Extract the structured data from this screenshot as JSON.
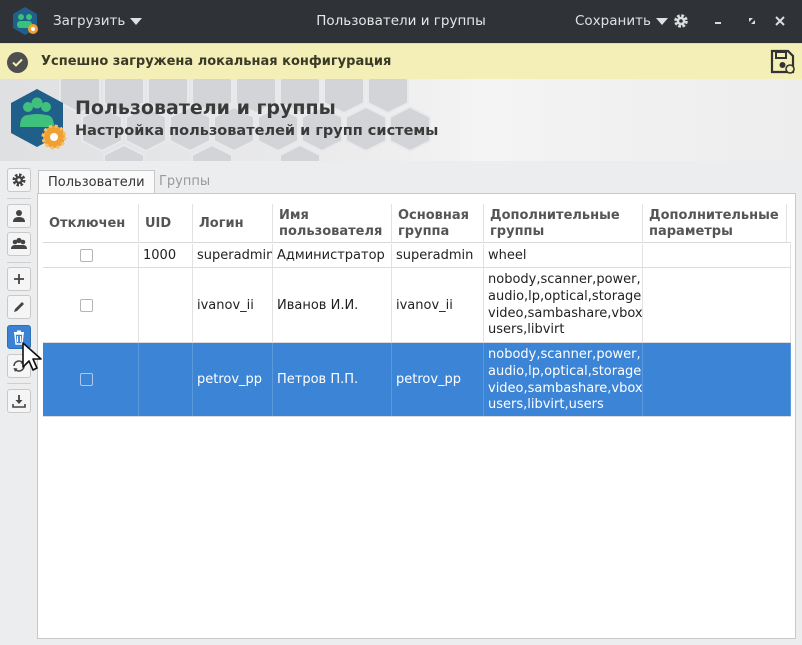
{
  "titlebar": {
    "load_label": "Загрузить",
    "window_title": "Пользователи и группы",
    "save_label": "Сохранить"
  },
  "notification": {
    "text": "Успешно загружена локальная конфигурация"
  },
  "header": {
    "title": "Пользователи и группы",
    "subtitle": "Настройка пользователей и групп системы"
  },
  "tabs": [
    {
      "label": "Пользователи",
      "active": true
    },
    {
      "label": "Группы",
      "active": false
    }
  ],
  "table": {
    "columns": [
      "Отключен",
      "UID",
      "Логин",
      "Имя пользователя",
      "Основная группа",
      "Дополнительные группы",
      "Дополнительные параметры"
    ],
    "rows": [
      {
        "disabled": false,
        "uid": "1000",
        "login": "superadmin",
        "name": "Администратор",
        "primary_group": "superadmin",
        "extra_groups": "wheel",
        "extra_params": "",
        "selected": false
      },
      {
        "disabled": false,
        "uid": "",
        "login": "ivanov_ii",
        "name": "Иванов И.И.",
        "primary_group": "ivanov_ii",
        "extra_groups": "nobody,scanner,power,\naudio,lp,optical,storage,\nvideo,sambashare,vbox-\nusers,libvirt",
        "extra_params": "",
        "selected": false
      },
      {
        "disabled": false,
        "uid": "",
        "login": "petrov_pp",
        "name": "Петров П.П.",
        "primary_group": "petrov_pp",
        "extra_groups": "nobody,scanner,power,\naudio,lp,optical,storage,\nvideo,sambashare,vbox-\nusers,libvirt,users",
        "extra_params": "",
        "selected": true
      }
    ]
  },
  "icons": {
    "settings": "gear-icon",
    "user": "user-icon",
    "group": "group-icon",
    "add": "plus-icon",
    "edit": "pencil-icon",
    "delete": "trash-icon",
    "refresh": "refresh-icon",
    "import": "download-icon"
  },
  "colors": {
    "accent": "#3c84d6",
    "notify_bg": "#f3efb6",
    "titlebar": "#2f3338",
    "logo": "#2fa37f",
    "badge": "#f0a030"
  }
}
